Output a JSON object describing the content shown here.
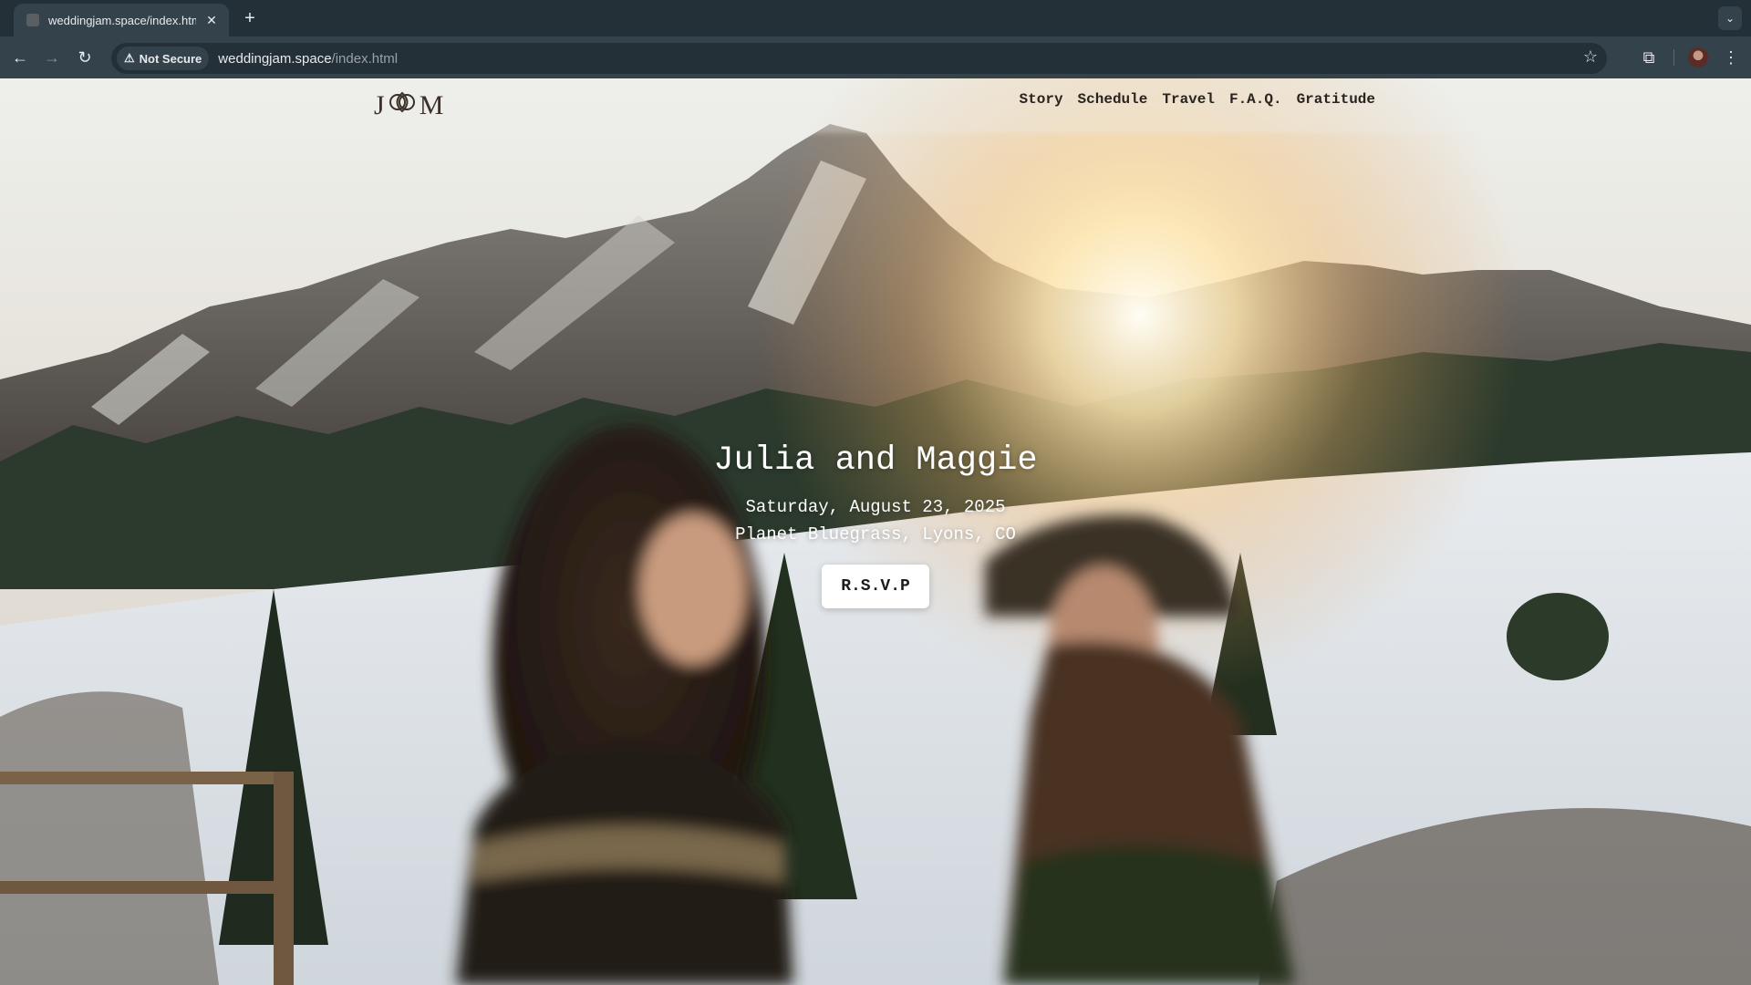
{
  "browser": {
    "tab_title": "weddingjam.space/index.html",
    "new_tab_icon": "plus-icon",
    "security_label": "Not Secure",
    "url_host": "weddingjam.space",
    "url_path": "/index.html"
  },
  "site": {
    "monogram_left": "J",
    "monogram_right": "M",
    "nav": [
      "Story",
      "Schedule",
      "Travel",
      "F.A.Q.",
      "Gratitude"
    ]
  },
  "hero": {
    "names": "Julia and Maggie",
    "date": "Saturday, August 23, 2025",
    "venue": "Planet Bluegrass, Lyons, CO",
    "rsvp_label": "R.S.V.P"
  },
  "colors": {
    "chrome_dark": "#243038",
    "chrome_toolbar": "#33424b",
    "nav_text": "#2a2320",
    "button_bg": "#ffffff"
  }
}
